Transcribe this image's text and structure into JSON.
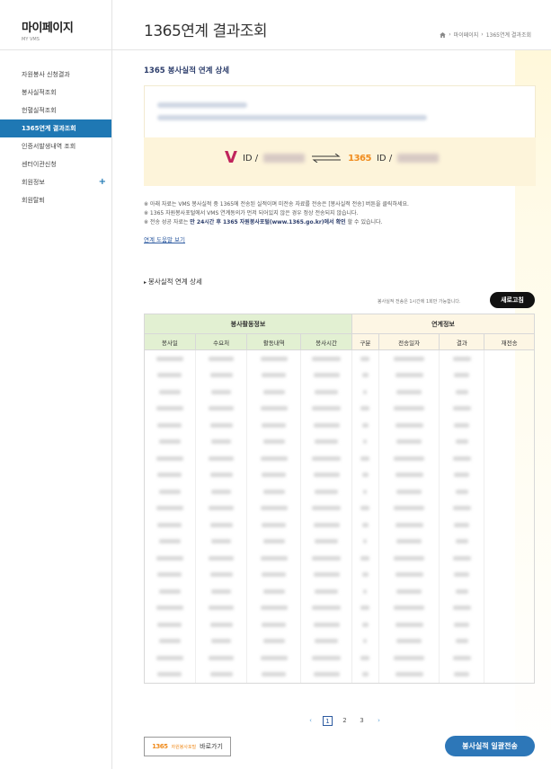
{
  "sidebar": {
    "title": "마이페이지",
    "subtitle": "MY VMS",
    "items": [
      {
        "label": "자원봉사 신청결과"
      },
      {
        "label": "봉사실적조회"
      },
      {
        "label": "헌혈실적조회"
      },
      {
        "label": "1365연계 결과조회",
        "active": true
      },
      {
        "label": "인증서발생내역 조회"
      },
      {
        "label": "센터이관신청"
      },
      {
        "label": "회원정보",
        "expandable": true
      },
      {
        "label": "회원탈퇴"
      }
    ],
    "plus_symbol": "+"
  },
  "header": {
    "title": "1365연계 결과조회",
    "breadcrumb": [
      "마이페이지",
      "1365연계 결과조회"
    ],
    "separator": "›"
  },
  "detail": {
    "section_title": "1365 봉사실적 연계 상세",
    "vms_logo": "V",
    "id_label_left": "ID /",
    "id_label_right": "ID /",
    "logo_1365": "1365",
    "notes": [
      "※ 아래 자료는 VMS 봉사실적 중 1365에 전송된 실적이며 미전송 자료를 전송은 [봉사실적 전송] 버튼을 클릭하세요.",
      "※ 1365 자원봉사포털에서 VMS 연계동의가 먼저 되어있지 않은 경우 정상 전송되지 않습니다."
    ],
    "note3_prefix": "※ 전송 성공 자료는 ",
    "note3_bold": "만 24시간 후 1365 자원봉사포털(www.1365.go.kr)에서 확인",
    "note3_suffix": " 할 수 있습니다.",
    "help_link": "연계 도움말 보기"
  },
  "table_section": {
    "title": "봉사실적 연계 상세",
    "refresh_note": "봉사실적 전송은 1시간에 1회만 가능합니다.",
    "refresh_button": "새로고침",
    "group_left": "봉사활동정보",
    "group_right": "연계정보",
    "columns": [
      "봉사일",
      "수요처",
      "활동내역",
      "봉사시간",
      "구분",
      "전송일자",
      "결과",
      "재전송"
    ],
    "row_count": 20
  },
  "pagination": {
    "prev": "‹",
    "next": "›",
    "pages": [
      "1",
      "2",
      "3"
    ],
    "current": "1"
  },
  "footer": {
    "portal_logo": "1365",
    "portal_text": "자원봉사포털",
    "portal_button": "바로가기",
    "send_button": "봉사실적 일괄전송"
  },
  "colors": {
    "accent": "#1f78b4",
    "header_green": "#e2f0d2",
    "header_yellow": "#fdf6e4",
    "vms_brand": "#c0245c",
    "brand_1365": "#f08c1e"
  }
}
